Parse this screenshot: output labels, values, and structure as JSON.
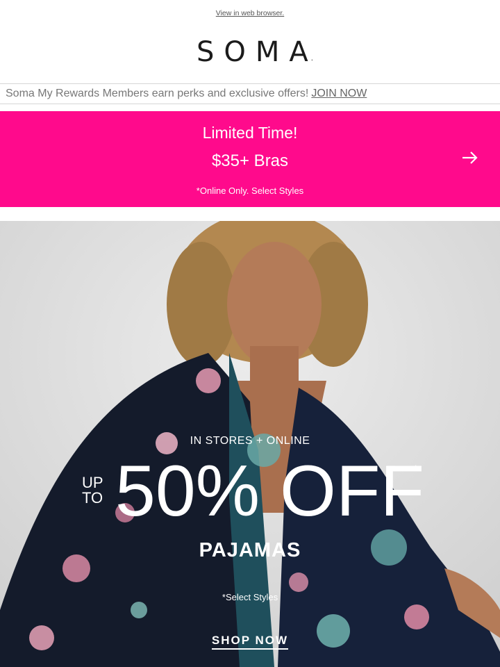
{
  "header": {
    "view_in_browser": "View in web browser.",
    "logo": "SOMA",
    "logo_mark": "."
  },
  "rewards_bar": {
    "text": "Soma My Rewards Members earn perks and exclusive offers!",
    "link": "JOIN NOW"
  },
  "promo": {
    "line1": "Limited Time!",
    "line2": "$35+ Bras",
    "line3": "*Online Only. Select Styles",
    "arrow_icon": "arrow-right-icon",
    "background": "#ff0a8c"
  },
  "hero": {
    "channel": "IN STORES + ONLINE",
    "up": "UP",
    "to": "TO",
    "discount": "50% OFF",
    "asterisk": "*",
    "category": "PAJAMAS",
    "disclaimer": "*Select Styles",
    "cta": "SHOP NOW"
  }
}
